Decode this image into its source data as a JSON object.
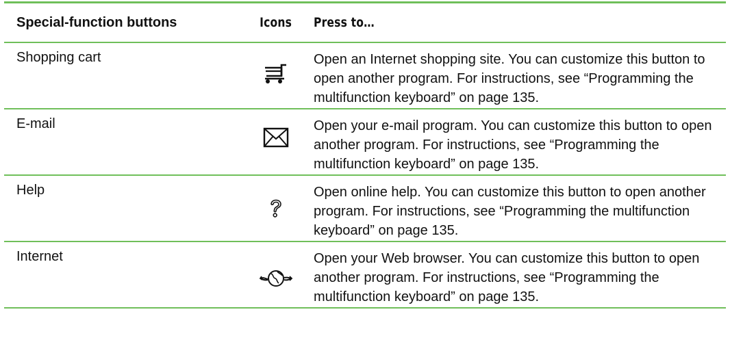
{
  "table": {
    "headers": {
      "name": "Special-function buttons",
      "icons": "Icons",
      "press": "Press to…"
    },
    "rows": [
      {
        "name": "Shopping cart",
        "icon": "shopping-cart-icon",
        "description": "Open an Internet shopping site. You can customize this button to open another program. For instructions, see “Programming the multifunction keyboard” on page 135."
      },
      {
        "name": "E-mail",
        "icon": "envelope-icon",
        "description": "Open your e-mail program. You can customize this button to open another program. For instructions, see “Programming the multifunction keyboard” on page 135."
      },
      {
        "name": "Help",
        "icon": "question-mark-icon",
        "description": "Open online help. You can customize this button to open another program. For instructions, see “Programming the multifunction keyboard” on page 135."
      },
      {
        "name": "Internet",
        "icon": "globe-arrows-icon",
        "description": "Open your Web browser. You can customize this button to open another program. For instructions, see “Programming the multifunction keyboard” on page 135."
      }
    ],
    "colors": {
      "rule": "#6fbf5a",
      "text": "#111111"
    }
  }
}
